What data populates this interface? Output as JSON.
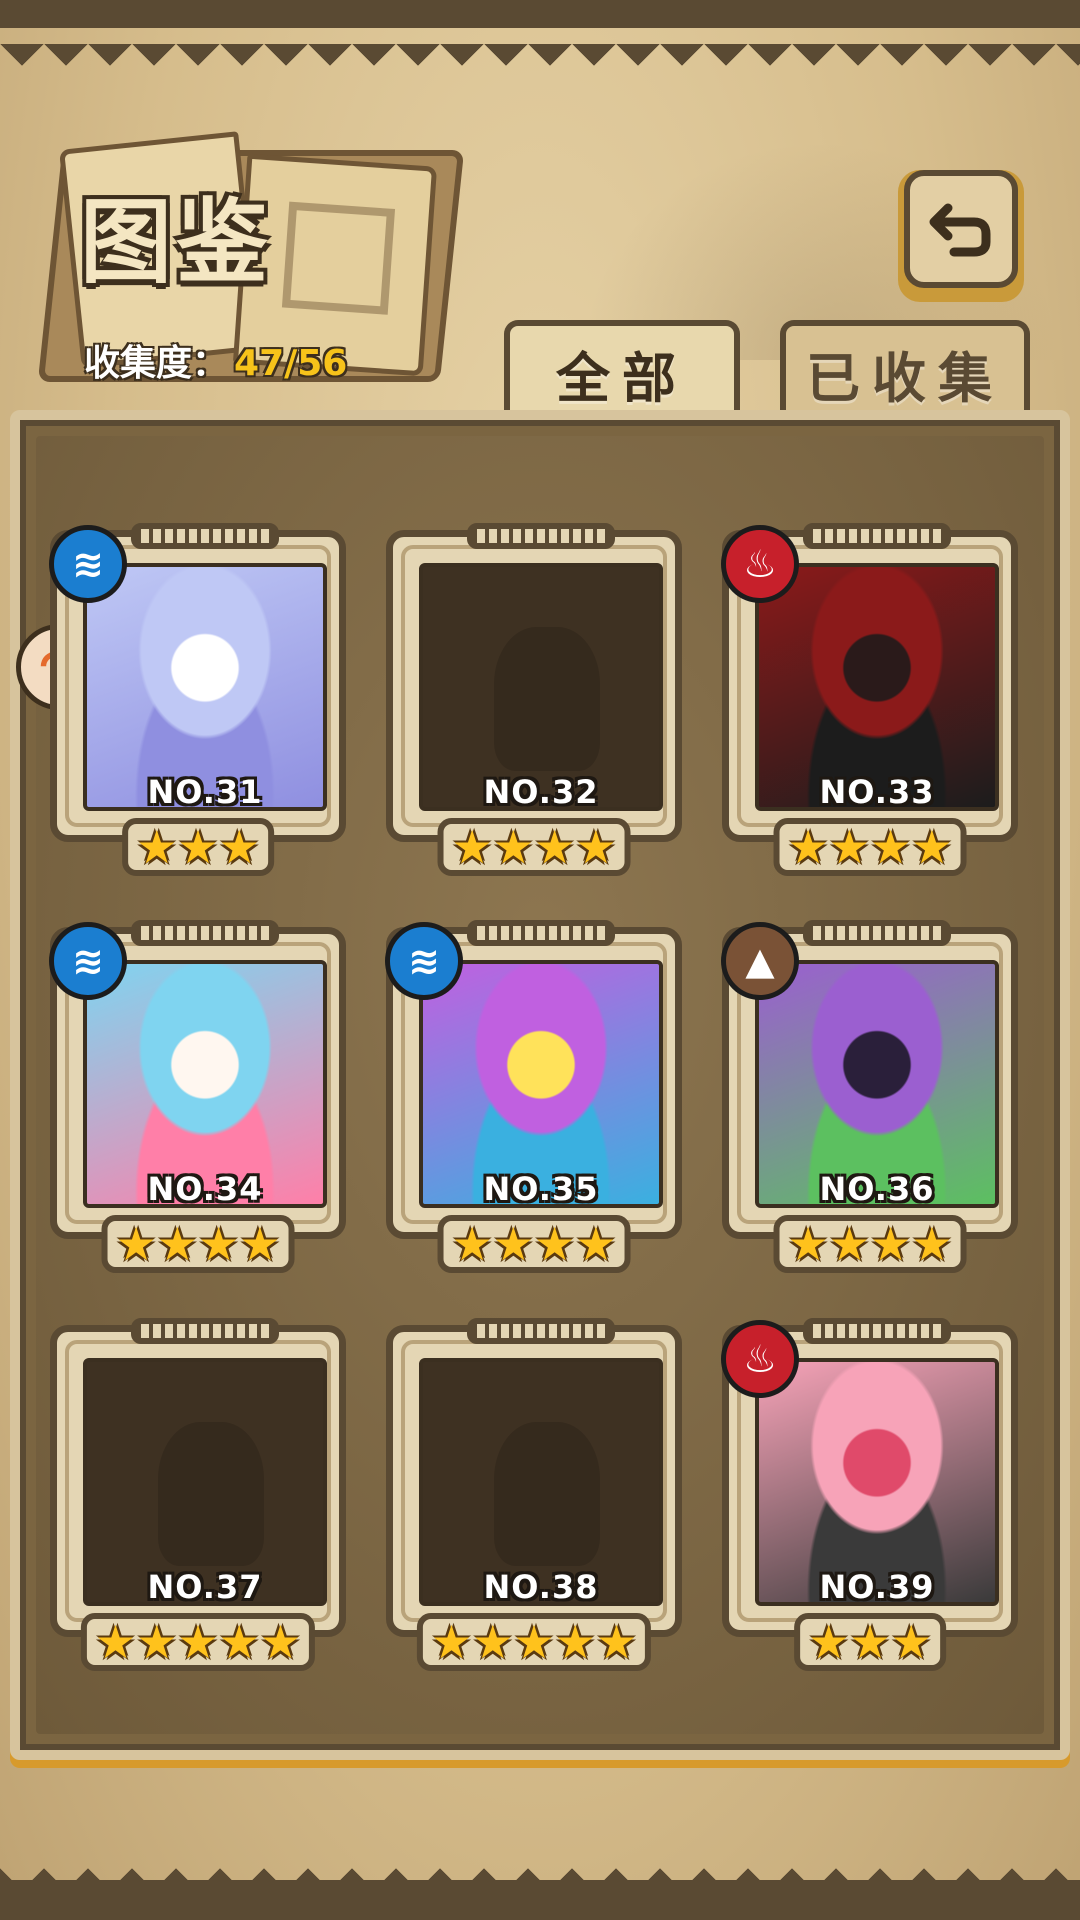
{
  "header": {
    "title": "图鉴",
    "collect_label": "收集度：",
    "collect_value": "47/56",
    "back_icon": "back-arrow-icon"
  },
  "tabs": [
    {
      "label": "全部",
      "active": true
    },
    {
      "label": "已收集",
      "active": false
    }
  ],
  "colors": {
    "water": "#1b7ed0",
    "fire": "#c7202b",
    "earth": "#7a5236",
    "star": "#ffc21c",
    "collect_value": "#f7c31a"
  },
  "cards": [
    {
      "no": "NO.31",
      "stars": "★★★",
      "element": "water",
      "element_icon": "≋",
      "locked": false,
      "portrait_colors": [
        "#ffffff",
        "#bfc8f5",
        "#8f8fe0"
      ]
    },
    {
      "no": "NO.32",
      "stars": "★★★★",
      "element": null,
      "element_icon": "",
      "locked": true
    },
    {
      "no": "NO.33",
      "stars": "★★★★",
      "element": "fire",
      "element_icon": "♨",
      "locked": false,
      "portrait_colors": [
        "#2a1a1a",
        "#8b1a1a",
        "#1c1c1c"
      ]
    },
    {
      "no": "NO.34",
      "stars": "★★★★",
      "element": "water",
      "element_icon": "≋",
      "locked": false,
      "portrait_colors": [
        "#fff7f0",
        "#7fd4f0",
        "#ff7fa8"
      ]
    },
    {
      "no": "NO.35",
      "stars": "★★★★",
      "element": "water",
      "element_icon": "≋",
      "locked": false,
      "portrait_colors": [
        "#ffe25a",
        "#c060e0",
        "#3ab0e0"
      ]
    },
    {
      "no": "NO.36",
      "stars": "★★★★",
      "element": "earth",
      "element_icon": "▲",
      "locked": false,
      "portrait_colors": [
        "#2a1f3a",
        "#9b5fd0",
        "#5cc060"
      ]
    },
    {
      "no": "NO.37",
      "stars": "★★★★★",
      "element": null,
      "element_icon": "",
      "locked": true
    },
    {
      "no": "NO.38",
      "stars": "★★★★★",
      "element": null,
      "element_icon": "",
      "locked": true
    },
    {
      "no": "NO.39",
      "stars": "★★★",
      "element": "fire",
      "element_icon": "♨",
      "locked": false,
      "portrait_colors": [
        "#e04a6a",
        "#f7a3b8",
        "#3a3a3a"
      ]
    }
  ],
  "side_badge_icon": "skip-arrow-icon"
}
